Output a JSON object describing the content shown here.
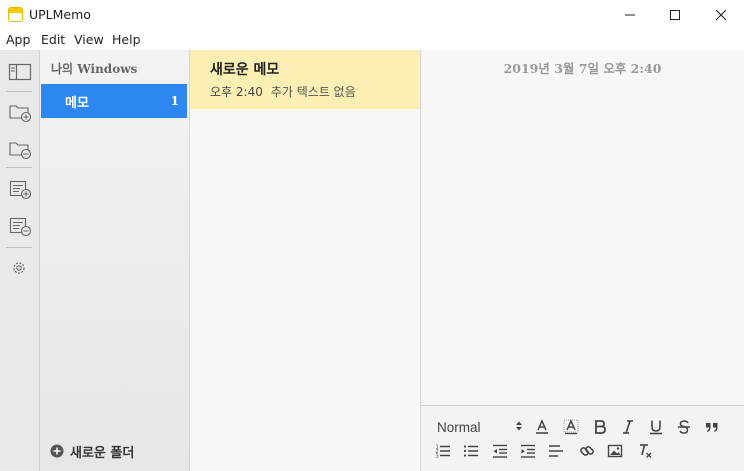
{
  "window": {
    "title": "UPLMemo",
    "minimize_icon": "minimize-icon",
    "maximize_icon": "maximize-icon",
    "close_icon": "close-icon"
  },
  "menu": {
    "items": [
      {
        "label": "App"
      },
      {
        "label": "Edit"
      },
      {
        "label": "View"
      },
      {
        "label": "Help"
      }
    ]
  },
  "rail": {
    "icons": [
      "sidebar-toggle-icon",
      "add-folder-icon",
      "remove-folder-icon",
      "add-note-icon",
      "remove-note-icon",
      "settings-icon"
    ]
  },
  "folders": {
    "header": "나의 Windows",
    "items": [
      {
        "label": "메모",
        "count": "1",
        "selected": true
      }
    ],
    "new_folder_label": "새로운 폴더"
  },
  "notes": {
    "items": [
      {
        "title": "새로운 메모",
        "time": "오후 2:40",
        "preview": "추가 텍스트 없음",
        "selected": true
      }
    ]
  },
  "editor": {
    "date": "2019년 3월 7일 오후 2:40",
    "toolbar": {
      "format_value": "Normal",
      "row1_icons": [
        "text-color-icon",
        "highlight-color-icon",
        "bold-icon",
        "italic-icon",
        "underline-icon",
        "strikethrough-icon",
        "blockquote-icon"
      ],
      "row2_icons": [
        "ordered-list-icon",
        "bullet-list-icon",
        "outdent-icon",
        "indent-icon",
        "align-icon",
        "link-icon",
        "image-icon",
        "clear-format-icon"
      ]
    }
  },
  "colors": {
    "accent": "#2e86f0",
    "selected_note": "#fbefb4"
  }
}
